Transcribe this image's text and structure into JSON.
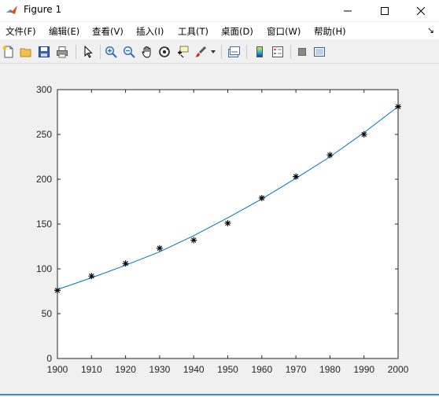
{
  "window": {
    "title": "Figure 1"
  },
  "menubar": {
    "items": [
      {
        "label": "文件(F)"
      },
      {
        "label": "编辑(E)"
      },
      {
        "label": "查看(V)"
      },
      {
        "label": "插入(I)"
      },
      {
        "label": "工具(T)"
      },
      {
        "label": "桌面(D)"
      },
      {
        "label": "窗口(W)"
      },
      {
        "label": "帮助(H)"
      }
    ],
    "overflow_arrow": "↘"
  },
  "toolbar": {
    "icons": [
      "new-figure-icon",
      "open-file-icon",
      "save-icon",
      "print-icon",
      "pointer-icon",
      "zoom-in-icon",
      "zoom-out-icon",
      "pan-hand-icon",
      "rotate-3d-icon",
      "data-cursor-icon",
      "brush-icon",
      "link-plot-icon",
      "colorbar-icon",
      "legend-icon",
      "hide-plot-tools-icon",
      "show-plot-tools-icon"
    ]
  },
  "chart_data": {
    "type": "scatter",
    "x": [
      1900,
      1910,
      1920,
      1930,
      1940,
      1950,
      1960,
      1970,
      1980,
      1990,
      2000
    ],
    "series": [
      {
        "marker": "*",
        "color": "#000000",
        "values": [
          76,
          92,
          106,
          123,
          132,
          151,
          179,
          203,
          227,
          250,
          281
        ]
      },
      {
        "style": "line",
        "color": "#0072BD",
        "values": [
          77,
          90,
          104,
          119,
          137,
          157,
          178,
          201,
          225,
          252,
          281
        ]
      }
    ],
    "xlim": [
      1900,
      2000
    ],
    "ylim": [
      0,
      300
    ],
    "xticks": [
      1900,
      1910,
      1920,
      1930,
      1940,
      1950,
      1960,
      1970,
      1980,
      1990,
      2000
    ],
    "yticks": [
      0,
      50,
      100,
      150,
      200,
      250,
      300
    ],
    "grid": false
  }
}
